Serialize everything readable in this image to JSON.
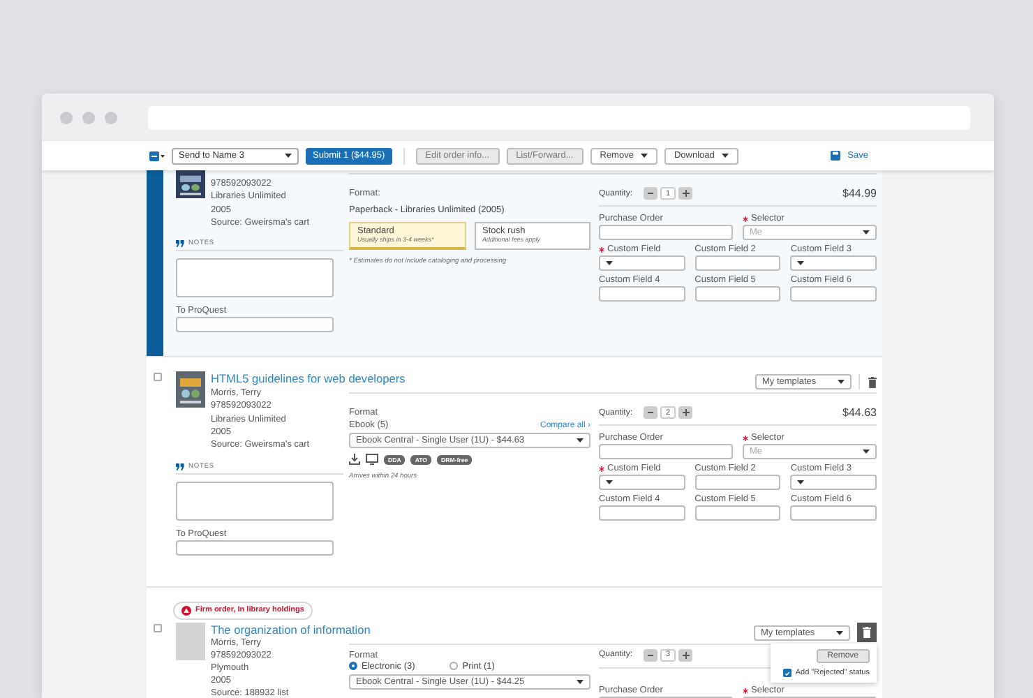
{
  "toolbar": {
    "send_to": "Send to Name 3",
    "submit": "Submit 1 ($44.95)",
    "actions": [
      {
        "label": "Edit order info...",
        "kind": "button",
        "disabled": true
      },
      {
        "label": "List/Forward...",
        "kind": "button",
        "disabled": true
      },
      {
        "label": "Remove",
        "kind": "menu",
        "disabled": false
      },
      {
        "label": "Download",
        "kind": "menu",
        "disabled": false
      }
    ],
    "save": "Save"
  },
  "items": [
    {
      "selected": true,
      "cover": {
        "kind": "image"
      },
      "meta": [
        "978592093022",
        "Libraries Unlimited",
        "2005",
        "Source: Gweirsma's cart"
      ],
      "notes_label": "NOTES",
      "proquest_label": "To ProQuest",
      "format": {
        "kind": "paperback",
        "label": "Format:",
        "value": "Paperback - Libraries Unlimited (2005)",
        "shipping": [
          {
            "title": "Standard",
            "subtitle": "Usually ships in 3-4 weeks*",
            "selected": true
          },
          {
            "title": "Stock rush",
            "subtitle": "Additional fees apply",
            "selected": false
          }
        ],
        "note": "* Estimates do not include cataloging and processing"
      },
      "quantity": {
        "label": "Quantity:",
        "value": "1"
      },
      "price": "$44.99",
      "field_rows": [
        [
          {
            "label": "Purchase Order",
            "kind": "text",
            "required": false
          },
          {
            "label": "Selector",
            "kind": "select",
            "required": true,
            "placeholder": "Me"
          }
        ],
        [
          {
            "label": "Custom Field",
            "kind": "select",
            "required": true
          },
          {
            "label": "Custom Field 2",
            "kind": "text",
            "required": false
          },
          {
            "label": "Custom Field 3",
            "kind": "select",
            "required": false
          }
        ],
        [
          {
            "label": "Custom Field 4",
            "kind": "text",
            "required": false
          },
          {
            "label": "Custom Field 5",
            "kind": "text",
            "required": false
          },
          {
            "label": "Custom Field 6",
            "kind": "text",
            "required": false
          }
        ]
      ]
    },
    {
      "selected": false,
      "checked": false,
      "title": "HTML5 guidelines for web developers",
      "templates": "My templates",
      "delete": {
        "kind": "icon"
      },
      "cover": {
        "kind": "image"
      },
      "meta": [
        "Morris, Terry",
        "978592093022",
        "Libraries Unlimited",
        "2005",
        "Source: Gweirsma's cart"
      ],
      "notes_label": "NOTES",
      "proquest_label": "To ProQuest",
      "format": {
        "kind": "ebook",
        "label": "Format",
        "sublabel": "Ebook (5)",
        "compare": "Compare all ›",
        "value": "Ebook Central - Single User (1U) - $44.63",
        "badges": [
          "DDA",
          "ATO",
          "DRM-free"
        ],
        "note": "Arrives within 24 hours"
      },
      "quantity": {
        "label": "Quantity:",
        "value": "2"
      },
      "price": "$44.63",
      "field_rows": [
        [
          {
            "label": "Purchase Order",
            "kind": "text",
            "required": false
          },
          {
            "label": "Selector",
            "kind": "select",
            "required": true,
            "placeholder": "Me"
          }
        ],
        [
          {
            "label": "Custom Field",
            "kind": "select",
            "required": true
          },
          {
            "label": "Custom Field 2",
            "kind": "text",
            "required": false
          },
          {
            "label": "Custom Field 3",
            "kind": "select",
            "required": false
          }
        ],
        [
          {
            "label": "Custom Field 4",
            "kind": "text",
            "required": false
          },
          {
            "label": "Custom Field 5",
            "kind": "text",
            "required": false
          },
          {
            "label": "Custom Field 6",
            "kind": "text",
            "required": false
          }
        ]
      ]
    },
    {
      "selected": false,
      "checked": false,
      "alert": "Firm order, In library holdings",
      "title": "The organization of information",
      "templates": "My templates",
      "delete": {
        "kind": "menu",
        "button": "Remove",
        "option": "Add \"Rejected\" status",
        "checked": true
      },
      "cover": {
        "kind": "blank"
      },
      "meta": [
        "Morris, Terry",
        "978592093022",
        "Plymouth",
        "2005",
        "Source: 188932 list"
      ],
      "format": {
        "kind": "choice",
        "label": "Format",
        "options": [
          {
            "label": "Electronic (3)",
            "selected": true
          },
          {
            "label": "Print (1)",
            "selected": false
          }
        ],
        "value": "Ebook Central - Single User (1U) - $44.25"
      },
      "quantity": {
        "label": "Quantity:",
        "value": "3"
      },
      "field_rows": [
        [
          {
            "label": "Purchase Order",
            "kind": "text",
            "required": false
          },
          {
            "label": "Selector",
            "kind": "select",
            "required": true
          }
        ]
      ]
    }
  ]
}
